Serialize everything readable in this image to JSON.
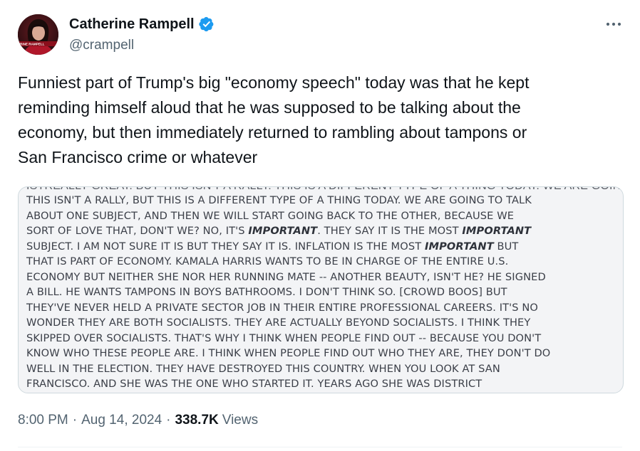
{
  "author": {
    "name": "Catherine Rampell",
    "handle": "@crampell",
    "avatar_caption": "RINE RAMPELL"
  },
  "tweet": {
    "text": "Funniest part of Trump's big \"economy speech\" today was that he kept\nreminding himself aloud that he was supposed to be talking about the\neconomy, but then immediately returned to rambling about tampons or\nSan Francisco crime or whatever"
  },
  "media": {
    "cut_line": "ISTREALLY GREAT. BUT THIS ISN'T A RALLY. THIS IS A DIFFERENT TYPE OF A THING TODAY. WE ARE GOING TO TALK",
    "lines": [
      [
        "THIS ISN'T A RALLY, BUT THIS IS A DIFFERENT TYPE OF A THING TODAY. WE ARE GOING TO TALK"
      ],
      [
        "ABOUT ONE SUBJECT, AND THEN WE WILL START GOING BACK TO THE OTHER, BECAUSE WE"
      ],
      [
        "SORT OF LOVE THAT, DON'T WE? NO, IT'S ",
        "IMPORTANT",
        ". THEY SAY IT IS THE MOST ",
        "IMPORTANT"
      ],
      [
        "SUBJECT. I AM NOT SURE IT IS BUT THEY SAY IT IS. INFLATION IS THE MOST ",
        "IMPORTANT",
        " BUT"
      ],
      [
        "THAT IS PART OF ECONOMY. KAMALA HARRIS WANTS TO BE IN CHARGE OF THE ENTIRE U.S."
      ],
      [
        "ECONOMY BUT NEITHER SHE NOR HER RUNNING MATE -- ANOTHER BEAUTY, ISN'T HE? HE SIGNED"
      ],
      [
        "A BILL. HE WANTS TAMPONS IN BOYS BATHROOMS. I DON'T THINK SO. [CROWD BOOS] BUT"
      ],
      [
        "THEY'VE NEVER HELD A PRIVATE SECTOR JOB IN THEIR ENTIRE PROFESSIONAL CAREERS. IT'S NO"
      ],
      [
        "WONDER THEY ARE BOTH SOCIALISTS. THEY ARE ACTUALLY BEYOND SOCIALISTS. I THINK THEY"
      ],
      [
        "SKIPPED OVER SOCIALISTS. THAT'S WHY I THINK WHEN PEOPLE FIND OUT -- BECAUSE YOU DON'T"
      ],
      [
        "KNOW WHO THESE PEOPLE ARE. I THINK WHEN PEOPLE FIND OUT WHO THEY ARE, THEY DON'T DO"
      ],
      [
        "WELL IN THE ELECTION. THEY HAVE DESTROYED THIS COUNTRY. WHEN YOU LOOK AT SAN"
      ],
      [
        "FRANCISCO. AND SHE WAS THE ONE WHO STARTED IT. YEARS AGO SHE WAS DISTRICT"
      ]
    ]
  },
  "meta": {
    "time": "8:00 PM",
    "separator": "·",
    "date": "Aug 14, 2024",
    "views_count": "338.7K",
    "views_label": "Views"
  },
  "colors": {
    "text_primary": "#0f1419",
    "text_secondary": "#536471",
    "verified_blue": "#1d9bf0",
    "media_border": "#cfd9de",
    "media_bg": "#f3f4f6"
  },
  "icons": {
    "verified": "verified-badge-icon",
    "more": "more-horizontal-icon"
  }
}
